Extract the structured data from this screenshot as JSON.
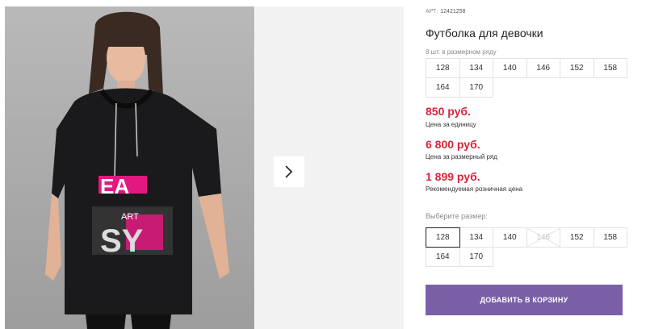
{
  "product": {
    "art_label": "АРТ",
    "art_number": "12421258",
    "title": "Футболка для девочки",
    "row_note": "8 шт. в размерном ряду"
  },
  "size_row": [
    "128",
    "134",
    "140",
    "146",
    "152",
    "158",
    "164",
    "170"
  ],
  "prices": {
    "unit_price": "850 руб.",
    "unit_label": "Цена за единицу",
    "row_price": "6 800 руб.",
    "row_label": "Цена за размерный ряд",
    "retail_price": "1 899 руб.",
    "retail_label": "Рекомендуемая розничная цена"
  },
  "size_select": {
    "label": "Выберите размер:",
    "options": [
      {
        "size": "128",
        "state": "selected"
      },
      {
        "size": "134",
        "state": "available"
      },
      {
        "size": "140",
        "state": "available"
      },
      {
        "size": "146",
        "state": "disabled"
      },
      {
        "size": "152",
        "state": "available"
      },
      {
        "size": "158",
        "state": "available"
      },
      {
        "size": "164",
        "state": "available"
      },
      {
        "size": "170",
        "state": "available"
      }
    ]
  },
  "cart_button": "Добавить в корзину",
  "print_letters": [
    "EA",
    "ART",
    "SY"
  ],
  "colors": {
    "accent_button": "#7a5fa7",
    "price_red": "#d6243a",
    "print_pink": "#e3187f"
  },
  "icons": {
    "next": "chevron-right-icon"
  }
}
